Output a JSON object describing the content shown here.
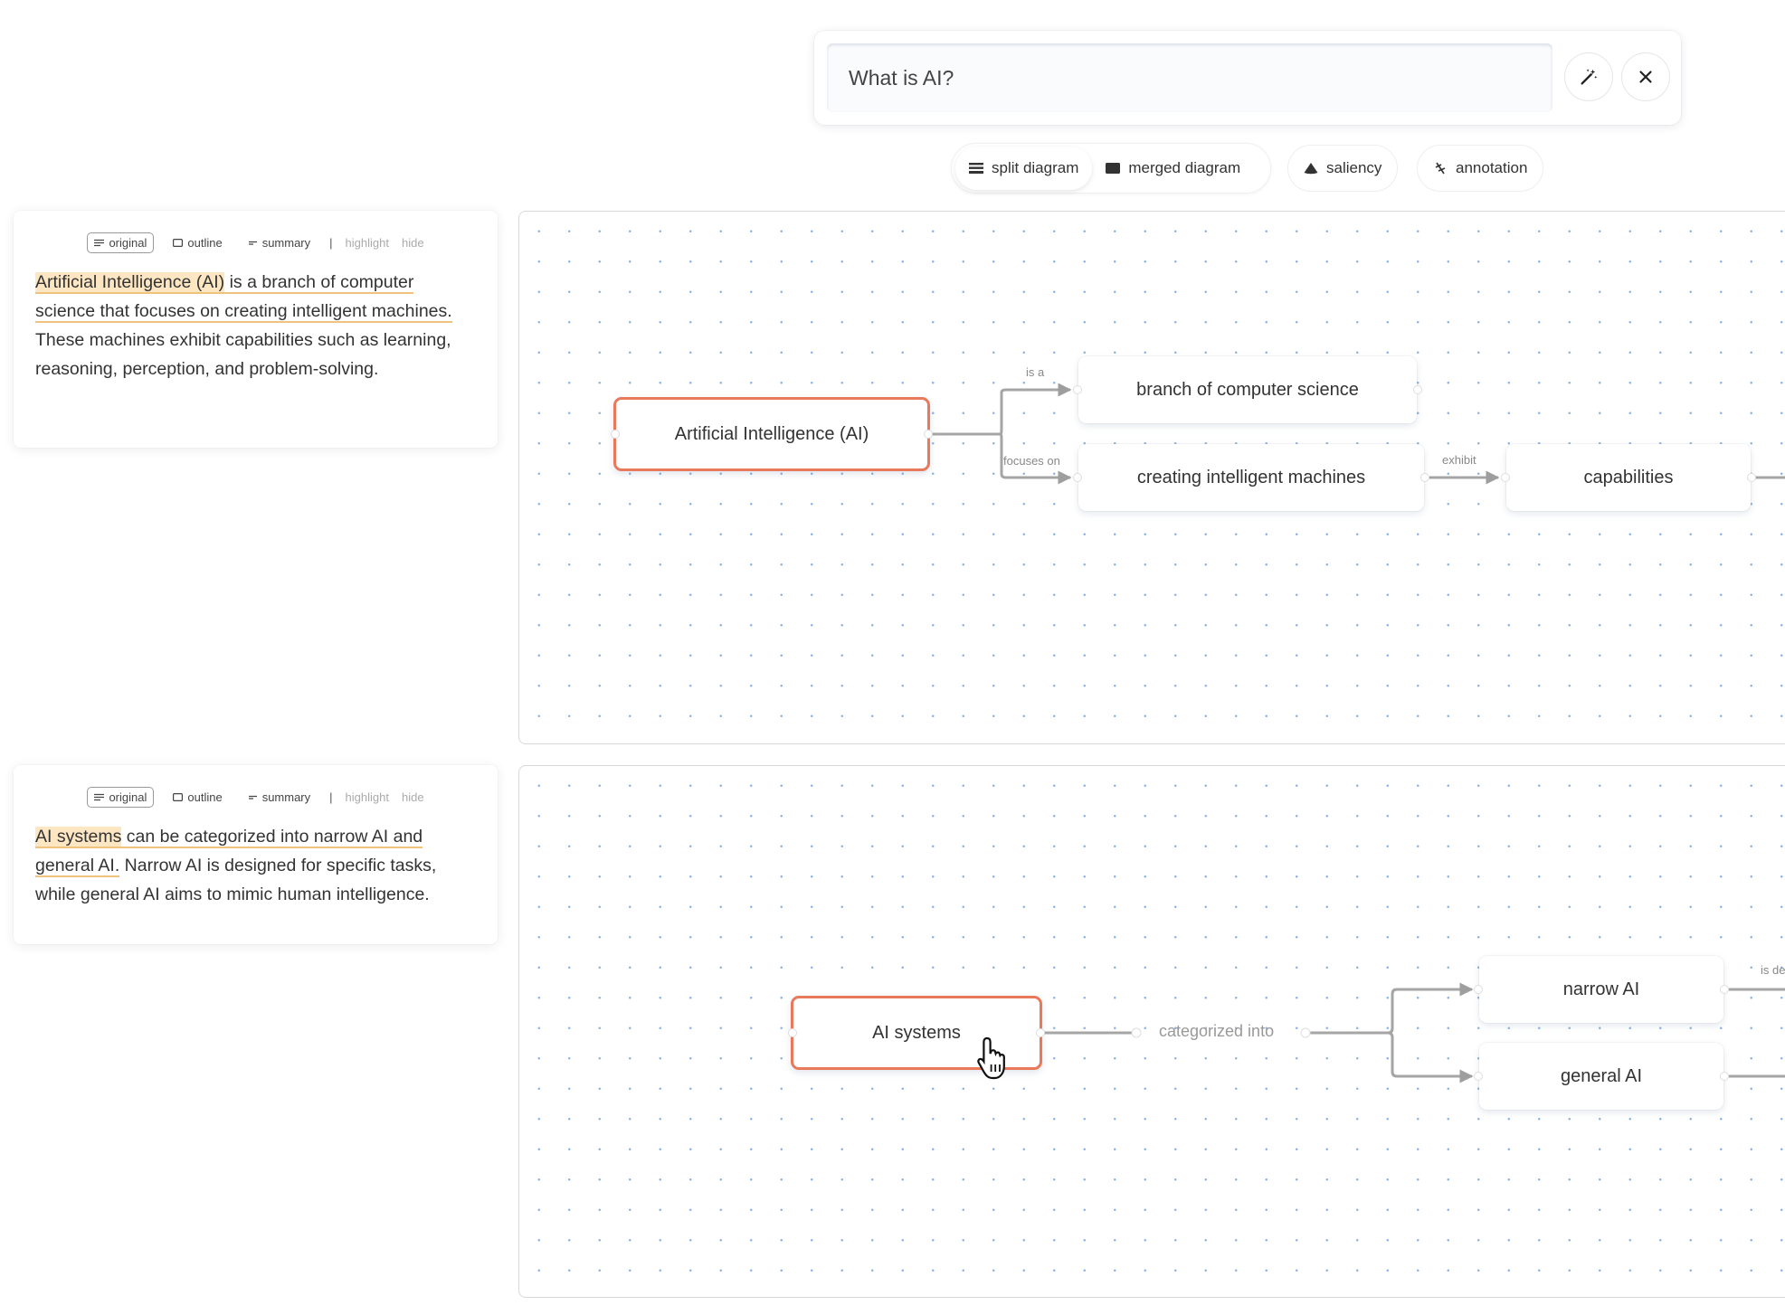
{
  "search": {
    "value": "What is AI?",
    "magic_button_icon": "magic-wand-icon",
    "close_button_icon": "close-icon"
  },
  "view_tabs": [
    {
      "label": "split diagram",
      "icon": "split-diagram-icon",
      "active": true
    },
    {
      "label": "merged diagram",
      "icon": "merged-diagram-icon",
      "active": false
    },
    {
      "label": "saliency",
      "icon": "saliency-icon",
      "active": false
    },
    {
      "label": "annotation",
      "icon": "annotation-icon",
      "active": false
    }
  ],
  "panel_toolbar": {
    "original": "original",
    "outline": "outline",
    "summary": "summary",
    "separator": "|",
    "highlight": "highlight",
    "hide": "hide"
  },
  "sections": [
    {
      "text_parts": [
        {
          "text": "Artificial Intelligence (AI)",
          "style": "highlight"
        },
        {
          "text": " is a branch of computer science that focuses on creating intelligent machines.",
          "style": "underline"
        },
        {
          "text": " These machines exhibit capabilities such as learning, reasoning, perception, and problem-solving.",
          "style": "plain"
        }
      ],
      "diagram": {
        "nodes": [
          {
            "id": "ai",
            "label": "Artificial Intelligence (AI)",
            "selected": true
          },
          {
            "id": "branch",
            "label": "branch of computer science",
            "selected": false
          },
          {
            "id": "creating",
            "label": "creating intelligent machines",
            "selected": false
          },
          {
            "id": "capabilities",
            "label": "capabilities",
            "selected": false
          }
        ],
        "edges": [
          {
            "from": "ai",
            "to": "branch",
            "label": "is a"
          },
          {
            "from": "ai",
            "to": "creating",
            "label": "focuses on"
          },
          {
            "from": "creating",
            "to": "capabilities",
            "label": "exhibit"
          }
        ]
      }
    },
    {
      "text_parts": [
        {
          "text": "AI systems",
          "style": "highlight"
        },
        {
          "text": " can be categorized into narrow AI and general AI.",
          "style": "underline"
        },
        {
          "text": " Narrow AI is designed for specific tasks, while general AI aims to mimic human intelligence.",
          "style": "plain"
        }
      ],
      "diagram": {
        "nodes": [
          {
            "id": "systems",
            "label": "AI systems",
            "selected": true
          },
          {
            "id": "narrow",
            "label": "narrow AI",
            "selected": false
          },
          {
            "id": "general",
            "label": "general AI",
            "selected": false
          }
        ],
        "relation_label": "categorized into",
        "edges": [
          {
            "from": "narrow",
            "to": "",
            "label": "is de"
          }
        ]
      }
    }
  ]
}
